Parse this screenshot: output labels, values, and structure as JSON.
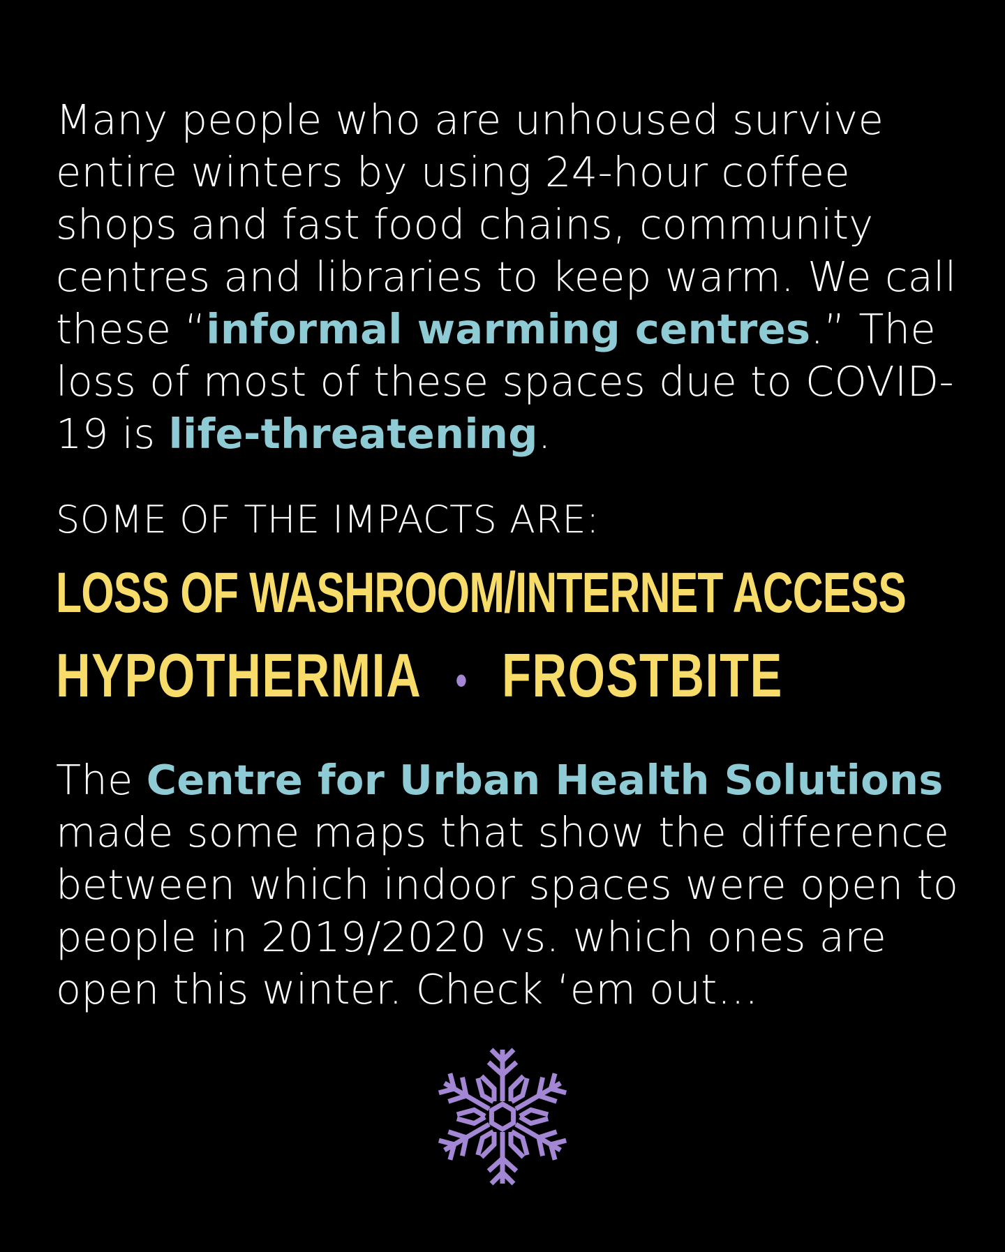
{
  "intro": {
    "t1": "Many people who are unhoused survive entire winters by using 24-hour coffee shops and fast food chains, community centres and libraries to keep warm. We call these “",
    "hl1": "informal warming centres",
    "t2": ".” The loss of most of these spaces due to COVID-19 is ",
    "hl2": "life-threatening",
    "t3": "."
  },
  "impacts": {
    "heading": "SOME OF THE IMPACTS ARE:",
    "item1": "LOSS OF WASHROOM/INTERNET ACCESS",
    "item2": "HYPOTHERMIA",
    "separator": "•",
    "item3": "FROSTBITE"
  },
  "outro": {
    "t1": "The ",
    "hl1": "Centre for Urban Health Solutions",
    "t2": " made some maps that show the difference between which indoor spaces were open to people in 2019/2020 vs. which ones are open this winter. Check ‘em out…"
  },
  "colors": {
    "background": "#000000",
    "text": "#ffffff",
    "highlight": "#8ecbd4",
    "impact": "#f8dc6a",
    "accent": "#a387d4"
  },
  "icons": {
    "footer": "snowflake-icon"
  }
}
